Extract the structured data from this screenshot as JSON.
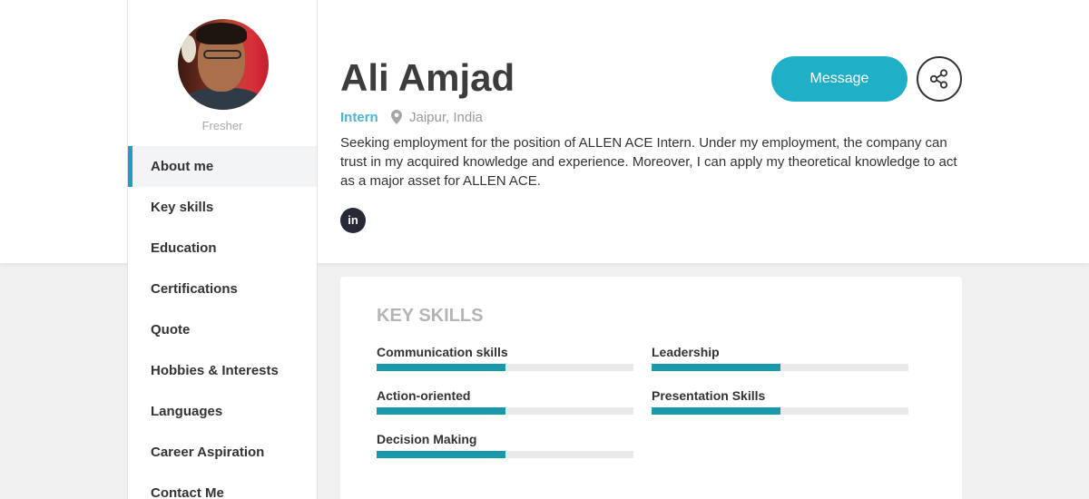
{
  "profile": {
    "level": "Fresher",
    "name": "Ali Amjad",
    "role": "Intern",
    "location": "Jaipur, India",
    "bio": "Seeking employment for the position of ALLEN ACE Intern. Under my employment, the company can trust in my acquired knowledge and experience. Moreover, I can apply my theoretical knowledge to act as a major asset for ALLEN ACE.",
    "linkedin_label": "in"
  },
  "actions": {
    "message_label": "Message"
  },
  "nav": {
    "items": [
      {
        "label": "About me"
      },
      {
        "label": "Key skills"
      },
      {
        "label": "Education"
      },
      {
        "label": "Certifications"
      },
      {
        "label": "Quote"
      },
      {
        "label": "Hobbies & Interests"
      },
      {
        "label": "Languages"
      },
      {
        "label": "Career Aspiration"
      },
      {
        "label": "Contact Me"
      }
    ]
  },
  "skills_card": {
    "title": "KEY SKILLS",
    "skills": [
      {
        "label": "Communication skills",
        "level": 0.5
      },
      {
        "label": "Leadership",
        "level": 0.5
      },
      {
        "label": "Action-oriented",
        "level": 0.5
      },
      {
        "label": "Presentation Skills",
        "level": 0.5
      },
      {
        "label": "Decision Making",
        "level": 0.5
      }
    ]
  },
  "colors": {
    "accent": "#1fb0c8",
    "bar_fill": "#1a99ad",
    "role_text": "#4ab6c8"
  }
}
